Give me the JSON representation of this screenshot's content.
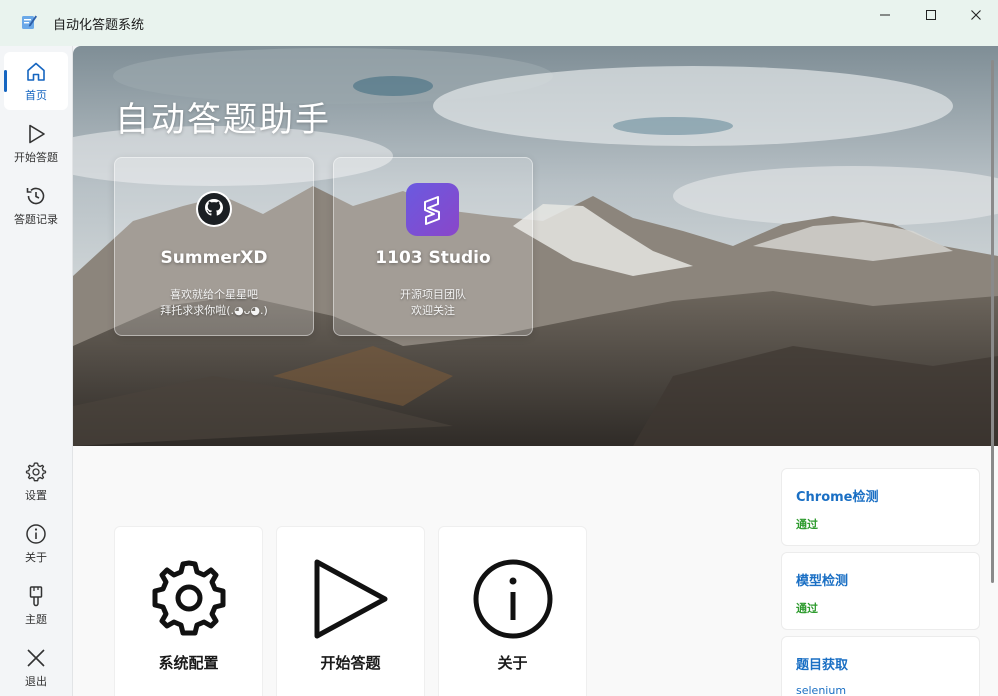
{
  "window": {
    "title": "自动化答题系统",
    "icon": "notepad-pencil-icon"
  },
  "sidebar": {
    "top_items": [
      {
        "label": "首页",
        "icon": "home-icon",
        "active": true
      },
      {
        "label": "开始答题",
        "icon": "play-icon",
        "active": false
      },
      {
        "label": "答题记录",
        "icon": "history-icon",
        "active": false
      }
    ],
    "bottom_items": [
      {
        "label": "设置",
        "icon": "gear-icon"
      },
      {
        "label": "关于",
        "icon": "info-icon"
      },
      {
        "label": "主题",
        "icon": "brush-icon"
      },
      {
        "label": "退出",
        "icon": "close-icon"
      }
    ]
  },
  "hero": {
    "title": "自动答题助手",
    "cards": [
      {
        "title": "SummerXD",
        "line1": "喜欢就给个星星吧",
        "line2": "拜托求求你啦(.◕ᴗ◕.)",
        "icon": "github-icon"
      },
      {
        "title": "1103 Studio",
        "line1": "开源项目团队",
        "line2": "欢迎关注",
        "icon": "studio-logo-icon"
      }
    ]
  },
  "tiles": [
    {
      "label": "系统配置",
      "icon": "gear-icon"
    },
    {
      "label": "开始答题",
      "icon": "play-icon"
    },
    {
      "label": "关于",
      "icon": "info-icon"
    }
  ],
  "status": [
    {
      "title": "Chrome检测",
      "value": "通过"
    },
    {
      "title": "模型检测",
      "value": "通过"
    },
    {
      "title": "题目获取",
      "value": "selenium"
    }
  ],
  "colors": {
    "accent": "#1565c0",
    "success": "#2e9b2e",
    "status_title": "#1a6fc4"
  }
}
